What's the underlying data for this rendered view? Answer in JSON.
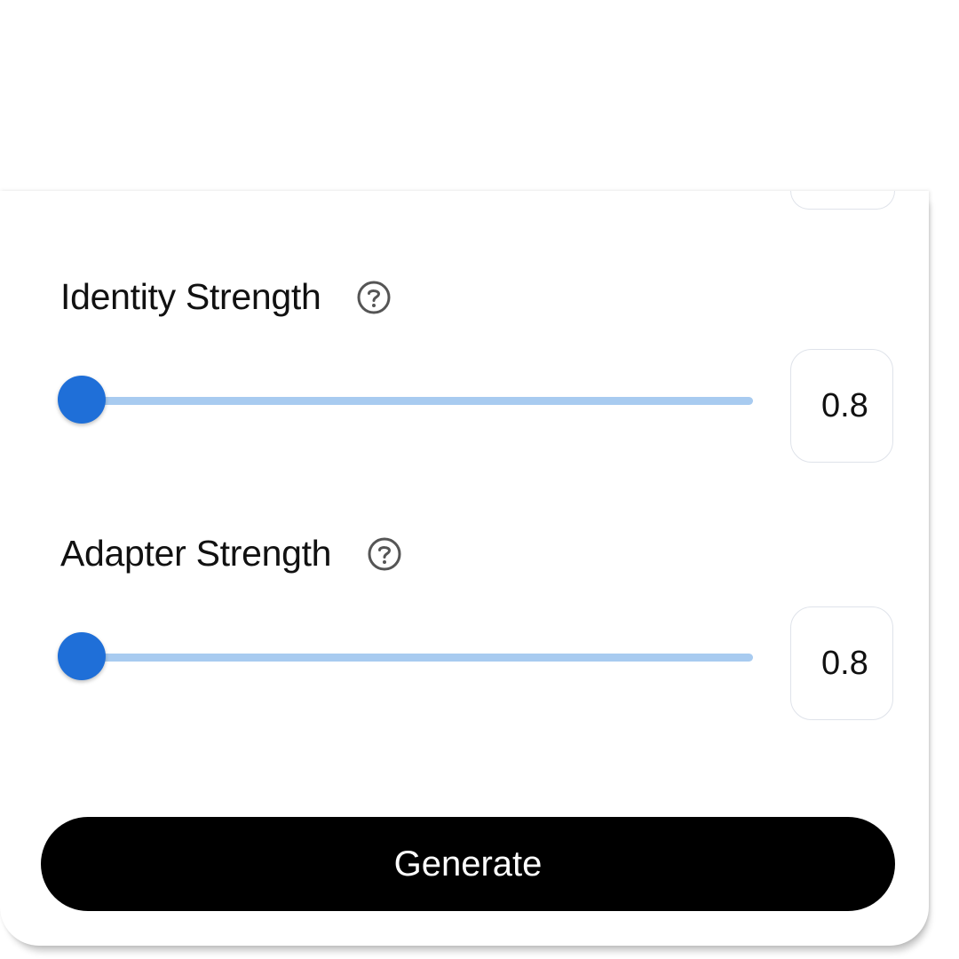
{
  "identity_strength": {
    "label": "Identity Strength",
    "help_icon": "question-circle-icon",
    "slider_fraction": 0.04,
    "value": "0.8"
  },
  "adapter_strength": {
    "label": "Adapter Strength",
    "help_icon": "question-circle-icon",
    "slider_fraction": 0.04,
    "value": "0.8"
  },
  "generate_button": {
    "label": "Generate"
  },
  "colors": {
    "accent": "#1f6fd8",
    "track": "#a8cbf0",
    "button_bg": "#000000",
    "button_text": "#ffffff",
    "border": "#dfe3ea"
  }
}
